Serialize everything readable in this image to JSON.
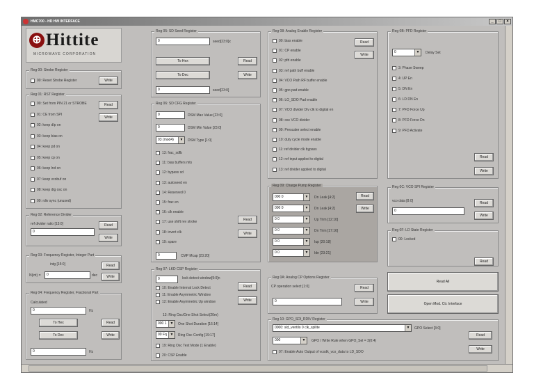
{
  "window": {
    "title": "HMC700 - HD HW INTERFACE",
    "btn_min": "_",
    "btn_max": "□",
    "btn_close": "×"
  },
  "logo": {
    "text": "Hittite",
    "sub": "MICROWAVE CORPORATION"
  },
  "reg00": {
    "title": "Reg 00: Strobe Register",
    "cb": "00: Reset Strobe Register",
    "write": "Write"
  },
  "reg01": {
    "title": "Reg 01: RST Register",
    "read": "Read",
    "write": "Write",
    "items": [
      "00: Set from PIN 21 or STROBE",
      "01: CE from SPI",
      "02: keep d/p on",
      "03: keep bias on",
      "04: keep pd on",
      "05: keep cp on",
      "06: keep lnd on",
      "07: keep vcobuf on",
      "08: keep dig osc on",
      "09: rdiv sync (unused)"
    ]
  },
  "reg02": {
    "title": "Reg 02: Reference Divider",
    "label": "ref divider ratio [13:0]",
    "value": "0",
    "read": "Read",
    "write": "Write"
  },
  "reg03": {
    "title": "Reg 03: Frequency Register, Integer Part",
    "label": "intg [15:0]",
    "prefix": "N(int) =",
    "value": "0",
    "read": "Read",
    "write": "Write"
  },
  "reg04": {
    "title": "Reg 04: Frequency Register, Fractional Part",
    "label": "Calculated",
    "unit": "Hz",
    "to_hex": "To Hex",
    "to_dec": "To Dec",
    "read": "Read",
    "write": "Write",
    "v1": "0",
    "v2": "0",
    "unit2": "Hz"
  },
  "reg05": {
    "title": "Reg 05: SD Seed Register",
    "value1": "0",
    "label1": "seed[23:0]x",
    "to_hex": "To Hex",
    "to_dec": "To Dec",
    "read": "Read",
    "write": "Write",
    "value2": "0",
    "label2": "seed[23:0]"
  },
  "reg06": {
    "title": "Reg 06: SD CFG Register",
    "max_val": "0",
    "max_lbl": "DSM Max Value [23:0]",
    "min_val": "0",
    "min_lbl": "DSM Min Value [23:0]",
    "type_val": "03 (mod4)",
    "type_lbl": "DSM Type [1:0]",
    "items": [
      "13: frac_sdfb",
      "11: bias buffers mts",
      "12: bypass sd",
      "13: autoseed en",
      "14: Reserved 0",
      "15: frac en",
      "16: clk enable",
      "17: use shift rev stroke",
      "18: invert clk",
      "19: spare"
    ],
    "read": "Read",
    "write": "Write",
    "cmp_val": "0",
    "cmp_lbl": "CMP Mcap [23:20]"
  },
  "reg07": {
    "title": "Reg 07: LKD CSP Register",
    "lock_val": "0",
    "lock_lbl": "lock detect window[9:0]n",
    "items": [
      "10: Enable Internal Lock Detect",
      "11: Enable Asymmetric Window",
      "12: Enable Asymmetric Up window"
    ],
    "read": "Read",
    "write": "Write",
    "sel1_val": "000 1",
    "sel1_lbl": "One Shot Duration [16:14]",
    "sel2_val": "00 Fq",
    "sel2_lbl": "Ring Osc Config [19:17]",
    "lbl_ring": "13: Ring Osc/One Shot Select(20m)",
    "cb1": "19: Ring Osc Test Mode (1 Enable)",
    "cb2": "20: CSP Enable"
  },
  "reg08": {
    "title": "Reg 08: Analog Enable Register",
    "read": "Read",
    "write": "Write",
    "items": [
      "00: bias enable",
      "01: CP enable",
      "02: pfd enable",
      "03: ref path buff enable",
      "04: VCO Path RF buffer enable",
      "05: gpo pad enable",
      "06: LO_SDO Pad enable",
      "07: VCO divider Div clk to digital en",
      "08: osc VCO divider",
      "09: Prescaler select enable",
      "10: duty cycle mode enable",
      "11: ref divider clk bypass",
      "12: ref input applied to digital",
      "13: ref divider applied to digital"
    ]
  },
  "reg09": {
    "title": "Reg 09: Charge Pump Register",
    "read": "Read",
    "write": "Write",
    "rows": [
      {
        "val": "000 0",
        "lbl": "Dn Leak [4:2]"
      },
      {
        "val": "000 0",
        "lbl": "Dn Leak [4:2]"
      },
      {
        "val": "0 0",
        "lbl": "Up Trim [12:10]"
      },
      {
        "val": "0 0",
        "lbl": "Dn Trim [17:16]"
      },
      {
        "val": "0 0",
        "lbl": "Iup [20:18]"
      },
      {
        "val": "0 0",
        "lbl": "Idn [23:21]"
      }
    ]
  },
  "reg0a": {
    "title": "Reg 0A: Analog CP Options Register",
    "label": "CP operation select [1:0]",
    "value": "0",
    "read": "Read",
    "write": "Write"
  },
  "reg0b": {
    "title": "Reg 0B: PFD Register",
    "sel_val": "0",
    "sel_lbl": "Delay Set",
    "items": [
      "3: Phase Sweep",
      "4: UP En",
      "5: DN En",
      "6: LD DN En",
      "7: PFD Force Up",
      "8: PFD Force Dn",
      "9: PFD Activate"
    ],
    "read": "Read",
    "write": "Write"
  },
  "reg0c": {
    "title": "Reg 0C: VCO SPI Register",
    "label": "vco data [8:0]",
    "value": "0",
    "read": "Read",
    "write": "Write"
  },
  "reg0f": {
    "title": "Reg 0F: LD State Register",
    "cb": "00: Locked",
    "read": "Read"
  },
  "read_all": "Read All",
  "open_mod": "Open Mod. Ctr. Interface",
  "reg10": {
    "title": "Reg 10: GPO_SDI_RDIV Register",
    "sel1": "0000: sld_ventilo 0 clk_spilite",
    "gpo_lbl": "GPO Select [3:0]",
    "sel2": "000",
    "sel2_lbl": "GPO / Write Rule when GPO_Sel = 3(0:4)",
    "cb": "07: Enable Auto Output of vcodk_vco_data to LD_SDO",
    "read": "Read",
    "write": "Write"
  }
}
